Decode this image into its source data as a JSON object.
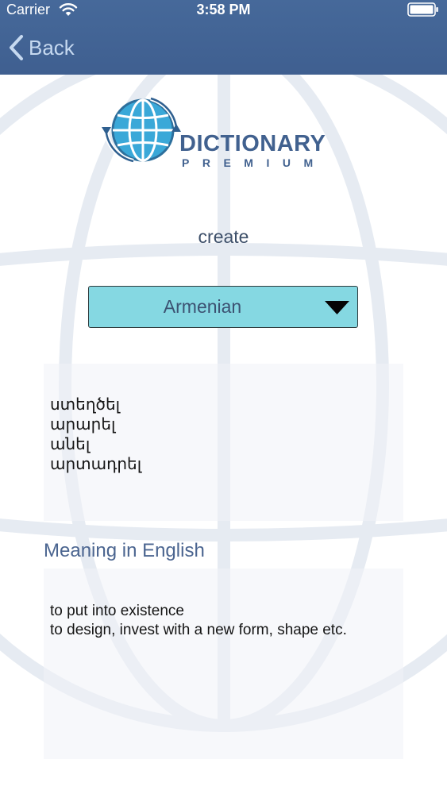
{
  "status_bar": {
    "carrier": "Carrier",
    "time": "3:58 PM"
  },
  "nav": {
    "back_label": "Back"
  },
  "logo": {
    "title": "DICTIONARY",
    "subtitle": "PREMIUM"
  },
  "search_word": "create",
  "language_dropdown": {
    "selected": "Armenian"
  },
  "translations": [
    "ստեղծել",
    "արարել",
    "անել",
    "արտադրել"
  ],
  "meaning_section": {
    "heading": "Meaning in English",
    "items": [
      "to put into existence",
      "to design, invest with a new form, shape etc."
    ]
  },
  "icons": {
    "wifi": "wifi-icon",
    "battery": "battery-icon",
    "back": "chevron-left-icon",
    "dropdown": "chevron-down-icon",
    "logo": "globe-icon"
  },
  "colors": {
    "nav_bar": "#43669a",
    "dropdown_fill": "#85d8e2",
    "heading": "#4b6590",
    "logo_text": "#41618f"
  }
}
